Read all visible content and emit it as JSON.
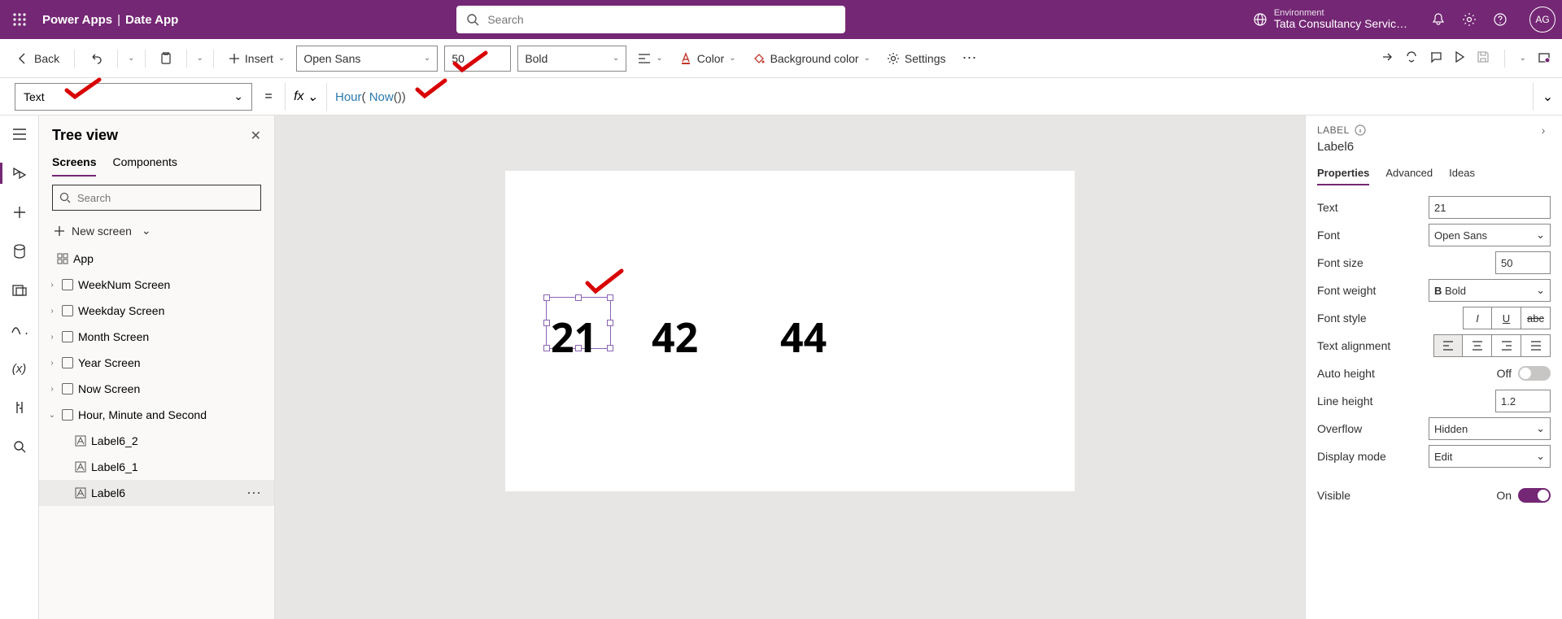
{
  "topbar": {
    "brand_left": "Power Apps",
    "brand_right": "Date App",
    "search_placeholder": "Search",
    "env_label": "Environment",
    "env_name": "Tata Consultancy Servic…",
    "avatar": "AG"
  },
  "ribbon": {
    "back": "Back",
    "insert": "Insert",
    "font": "Open Sans",
    "size": "50",
    "weight": "Bold",
    "color": "Color",
    "bg": "Background color",
    "settings": "Settings"
  },
  "proprow": {
    "prop": "Text"
  },
  "formula": {
    "fn": "Hour",
    "inner": "Now"
  },
  "tree": {
    "title": "Tree view",
    "tab_screens": "Screens",
    "tab_components": "Components",
    "search_placeholder": "Search",
    "new_screen": "New screen",
    "app": "App",
    "screens": [
      "WeekNum Screen",
      "Weekday Screen",
      "Month Screen",
      "Year Screen",
      "Now Screen",
      "Hour, Minute and Second"
    ],
    "controls": [
      "Label6_2",
      "Label6_1",
      "Label6"
    ]
  },
  "canvas": {
    "v1": "21",
    "v2": "42",
    "v3": "44"
  },
  "props": {
    "header": "LABEL",
    "name": "Label6",
    "tab_props": "Properties",
    "tab_adv": "Advanced",
    "tab_ideas": "Ideas",
    "text_label": "Text",
    "text_value": "21",
    "font_label": "Font",
    "font_value": "Open Sans",
    "fs_label": "Font size",
    "fs_value": "50",
    "fw_label": "Font weight",
    "fw_value": "Bold",
    "fstyle_label": "Font style",
    "align_label": "Text alignment",
    "ah_label": "Auto height",
    "ah_val": "Off",
    "lh_label": "Line height",
    "lh_value": "1.2",
    "ov_label": "Overflow",
    "ov_value": "Hidden",
    "dm_label": "Display mode",
    "dm_value": "Edit",
    "vis_label": "Visible",
    "vis_val": "On"
  }
}
